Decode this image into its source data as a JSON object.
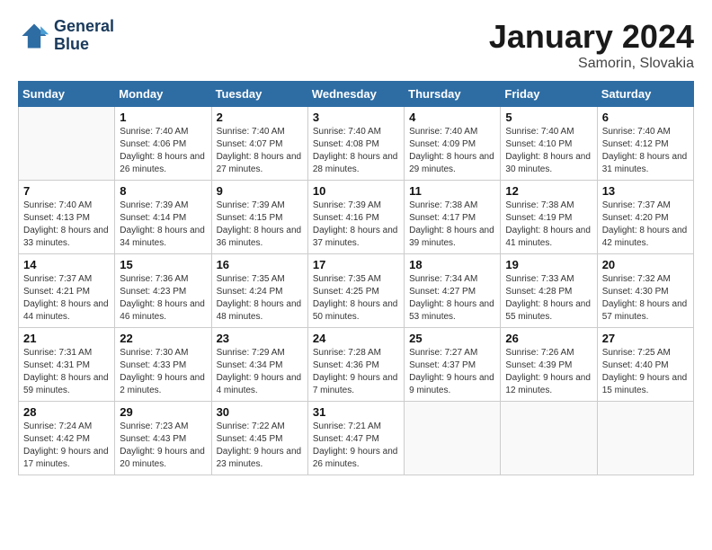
{
  "header": {
    "logo_line1": "General",
    "logo_line2": "Blue",
    "month_year": "January 2024",
    "location": "Samorin, Slovakia"
  },
  "weekdays": [
    "Sunday",
    "Monday",
    "Tuesday",
    "Wednesday",
    "Thursday",
    "Friday",
    "Saturday"
  ],
  "weeks": [
    [
      {
        "day": "",
        "sunrise": "",
        "sunset": "",
        "daylight": ""
      },
      {
        "day": "1",
        "sunrise": "Sunrise: 7:40 AM",
        "sunset": "Sunset: 4:06 PM",
        "daylight": "Daylight: 8 hours and 26 minutes."
      },
      {
        "day": "2",
        "sunrise": "Sunrise: 7:40 AM",
        "sunset": "Sunset: 4:07 PM",
        "daylight": "Daylight: 8 hours and 27 minutes."
      },
      {
        "day": "3",
        "sunrise": "Sunrise: 7:40 AM",
        "sunset": "Sunset: 4:08 PM",
        "daylight": "Daylight: 8 hours and 28 minutes."
      },
      {
        "day": "4",
        "sunrise": "Sunrise: 7:40 AM",
        "sunset": "Sunset: 4:09 PM",
        "daylight": "Daylight: 8 hours and 29 minutes."
      },
      {
        "day": "5",
        "sunrise": "Sunrise: 7:40 AM",
        "sunset": "Sunset: 4:10 PM",
        "daylight": "Daylight: 8 hours and 30 minutes."
      },
      {
        "day": "6",
        "sunrise": "Sunrise: 7:40 AM",
        "sunset": "Sunset: 4:12 PM",
        "daylight": "Daylight: 8 hours and 31 minutes."
      }
    ],
    [
      {
        "day": "7",
        "sunrise": "Sunrise: 7:40 AM",
        "sunset": "Sunset: 4:13 PM",
        "daylight": "Daylight: 8 hours and 33 minutes."
      },
      {
        "day": "8",
        "sunrise": "Sunrise: 7:39 AM",
        "sunset": "Sunset: 4:14 PM",
        "daylight": "Daylight: 8 hours and 34 minutes."
      },
      {
        "day": "9",
        "sunrise": "Sunrise: 7:39 AM",
        "sunset": "Sunset: 4:15 PM",
        "daylight": "Daylight: 8 hours and 36 minutes."
      },
      {
        "day": "10",
        "sunrise": "Sunrise: 7:39 AM",
        "sunset": "Sunset: 4:16 PM",
        "daylight": "Daylight: 8 hours and 37 minutes."
      },
      {
        "day": "11",
        "sunrise": "Sunrise: 7:38 AM",
        "sunset": "Sunset: 4:17 PM",
        "daylight": "Daylight: 8 hours and 39 minutes."
      },
      {
        "day": "12",
        "sunrise": "Sunrise: 7:38 AM",
        "sunset": "Sunset: 4:19 PM",
        "daylight": "Daylight: 8 hours and 41 minutes."
      },
      {
        "day": "13",
        "sunrise": "Sunrise: 7:37 AM",
        "sunset": "Sunset: 4:20 PM",
        "daylight": "Daylight: 8 hours and 42 minutes."
      }
    ],
    [
      {
        "day": "14",
        "sunrise": "Sunrise: 7:37 AM",
        "sunset": "Sunset: 4:21 PM",
        "daylight": "Daylight: 8 hours and 44 minutes."
      },
      {
        "day": "15",
        "sunrise": "Sunrise: 7:36 AM",
        "sunset": "Sunset: 4:23 PM",
        "daylight": "Daylight: 8 hours and 46 minutes."
      },
      {
        "day": "16",
        "sunrise": "Sunrise: 7:35 AM",
        "sunset": "Sunset: 4:24 PM",
        "daylight": "Daylight: 8 hours and 48 minutes."
      },
      {
        "day": "17",
        "sunrise": "Sunrise: 7:35 AM",
        "sunset": "Sunset: 4:25 PM",
        "daylight": "Daylight: 8 hours and 50 minutes."
      },
      {
        "day": "18",
        "sunrise": "Sunrise: 7:34 AM",
        "sunset": "Sunset: 4:27 PM",
        "daylight": "Daylight: 8 hours and 53 minutes."
      },
      {
        "day": "19",
        "sunrise": "Sunrise: 7:33 AM",
        "sunset": "Sunset: 4:28 PM",
        "daylight": "Daylight: 8 hours and 55 minutes."
      },
      {
        "day": "20",
        "sunrise": "Sunrise: 7:32 AM",
        "sunset": "Sunset: 4:30 PM",
        "daylight": "Daylight: 8 hours and 57 minutes."
      }
    ],
    [
      {
        "day": "21",
        "sunrise": "Sunrise: 7:31 AM",
        "sunset": "Sunset: 4:31 PM",
        "daylight": "Daylight: 8 hours and 59 minutes."
      },
      {
        "day": "22",
        "sunrise": "Sunrise: 7:30 AM",
        "sunset": "Sunset: 4:33 PM",
        "daylight": "Daylight: 9 hours and 2 minutes."
      },
      {
        "day": "23",
        "sunrise": "Sunrise: 7:29 AM",
        "sunset": "Sunset: 4:34 PM",
        "daylight": "Daylight: 9 hours and 4 minutes."
      },
      {
        "day": "24",
        "sunrise": "Sunrise: 7:28 AM",
        "sunset": "Sunset: 4:36 PM",
        "daylight": "Daylight: 9 hours and 7 minutes."
      },
      {
        "day": "25",
        "sunrise": "Sunrise: 7:27 AM",
        "sunset": "Sunset: 4:37 PM",
        "daylight": "Daylight: 9 hours and 9 minutes."
      },
      {
        "day": "26",
        "sunrise": "Sunrise: 7:26 AM",
        "sunset": "Sunset: 4:39 PM",
        "daylight": "Daylight: 9 hours and 12 minutes."
      },
      {
        "day": "27",
        "sunrise": "Sunrise: 7:25 AM",
        "sunset": "Sunset: 4:40 PM",
        "daylight": "Daylight: 9 hours and 15 minutes."
      }
    ],
    [
      {
        "day": "28",
        "sunrise": "Sunrise: 7:24 AM",
        "sunset": "Sunset: 4:42 PM",
        "daylight": "Daylight: 9 hours and 17 minutes."
      },
      {
        "day": "29",
        "sunrise": "Sunrise: 7:23 AM",
        "sunset": "Sunset: 4:43 PM",
        "daylight": "Daylight: 9 hours and 20 minutes."
      },
      {
        "day": "30",
        "sunrise": "Sunrise: 7:22 AM",
        "sunset": "Sunset: 4:45 PM",
        "daylight": "Daylight: 9 hours and 23 minutes."
      },
      {
        "day": "31",
        "sunrise": "Sunrise: 7:21 AM",
        "sunset": "Sunset: 4:47 PM",
        "daylight": "Daylight: 9 hours and 26 minutes."
      },
      {
        "day": "",
        "sunrise": "",
        "sunset": "",
        "daylight": ""
      },
      {
        "day": "",
        "sunrise": "",
        "sunset": "",
        "daylight": ""
      },
      {
        "day": "",
        "sunrise": "",
        "sunset": "",
        "daylight": ""
      }
    ]
  ]
}
